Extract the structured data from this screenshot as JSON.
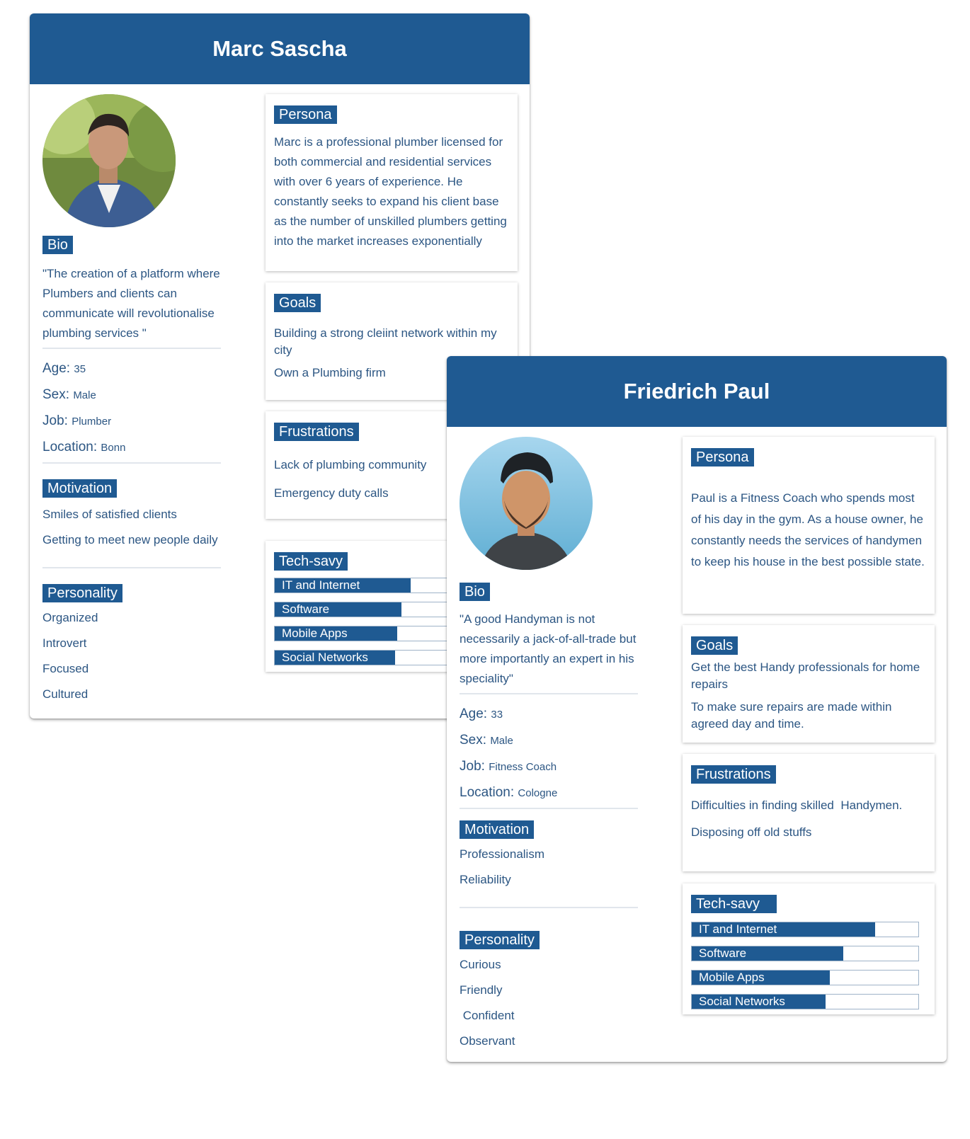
{
  "colors": {
    "accent": "#1f5a92",
    "text": "#2c5683",
    "divider": "#e1e6ec"
  },
  "personas": [
    {
      "name": "Marc Sascha",
      "avatar_icon": "male-portrait-outdoor",
      "bio_tag": "Bio",
      "bio": "\"The creation of a platform where Plumbers and clients can communicate will revolutionalise plumbing services \"",
      "age_label": "Age:",
      "age": "35",
      "sex_label": "Sex:",
      "sex": "Male",
      "job_label": "Job:",
      "job": "Plumber",
      "location_label": "Location:",
      "location": "Bonn",
      "motivation_tag": "Motivation",
      "motivation": [
        "Smiles of satisfied clients",
        "Getting to meet new people daily"
      ],
      "personality_tag": "Personality",
      "personality": [
        "Organized",
        "Introvert",
        "Focused",
        "Cultured"
      ],
      "persona_tag": "Persona",
      "persona_text": "Marc is a professional plumber licensed for both commercial and residential services with over 6 years of experience. He constantly seeks to expand his client base as the number of unskilled plumbers getting into the market increases exponentially",
      "goals_tag": "Goals",
      "goals": [
        "Building a strong cleiint network within my city",
        "Own a Plumbing firm"
      ],
      "frustrations_tag": "Frustrations",
      "frustrations": [
        "Lack of plumbing community",
        "Emergency duty calls"
      ],
      "tech_tag": "Tech-savy",
      "tech": [
        {
          "label": "IT and Internet",
          "level": 0.6
        },
        {
          "label": "Software",
          "level": 0.56
        },
        {
          "label": "Mobile Apps",
          "level": 0.54
        },
        {
          "label": "Social Networks",
          "level": 0.53
        }
      ]
    },
    {
      "name": "Friedrich Paul",
      "avatar_icon": "male-portrait-cap",
      "bio_tag": "Bio",
      "bio": "\"A good Handyman is not necessarily a jack-of-all-trade but more importantly an expert in his speciality\"",
      "age_label": "Age:",
      "age": "33",
      "sex_label": "Sex:",
      "sex": "Male",
      "job_label": "Job:",
      "job": "Fitness Coach",
      "location_label": "Location:",
      "location": "Cologne",
      "motivation_tag": "Motivation",
      "motivation": [
        "Professionalism",
        "Reliability"
      ],
      "personality_tag": "Personality",
      "personality": [
        "Curious",
        "Friendly",
        " Confident",
        "Observant"
      ],
      "persona_tag": "Persona",
      "persona_text": "Paul is a Fitness Coach who spends most of his day in the gym. As a house owner, he constantly needs the services of handymen to keep his house in the best possible state.",
      "goals_tag": "Goals",
      "goals": [
        "Get the best Handy professionals for home repairs",
        "To make sure repairs are made within agreed day and time."
      ],
      "frustrations_tag": "Frustrations",
      "frustrations": [
        "Difficulties in finding skilled  Handymen.",
        "Disposing off old stuffs"
      ],
      "tech_tag": "Tech-savy",
      "tech": [
        {
          "label": "IT and Internet",
          "level": 0.81
        },
        {
          "label": "Software",
          "level": 0.67
        },
        {
          "label": "Mobile Apps",
          "level": 0.61
        },
        {
          "label": "Social Networks",
          "level": 0.59
        }
      ]
    }
  ]
}
